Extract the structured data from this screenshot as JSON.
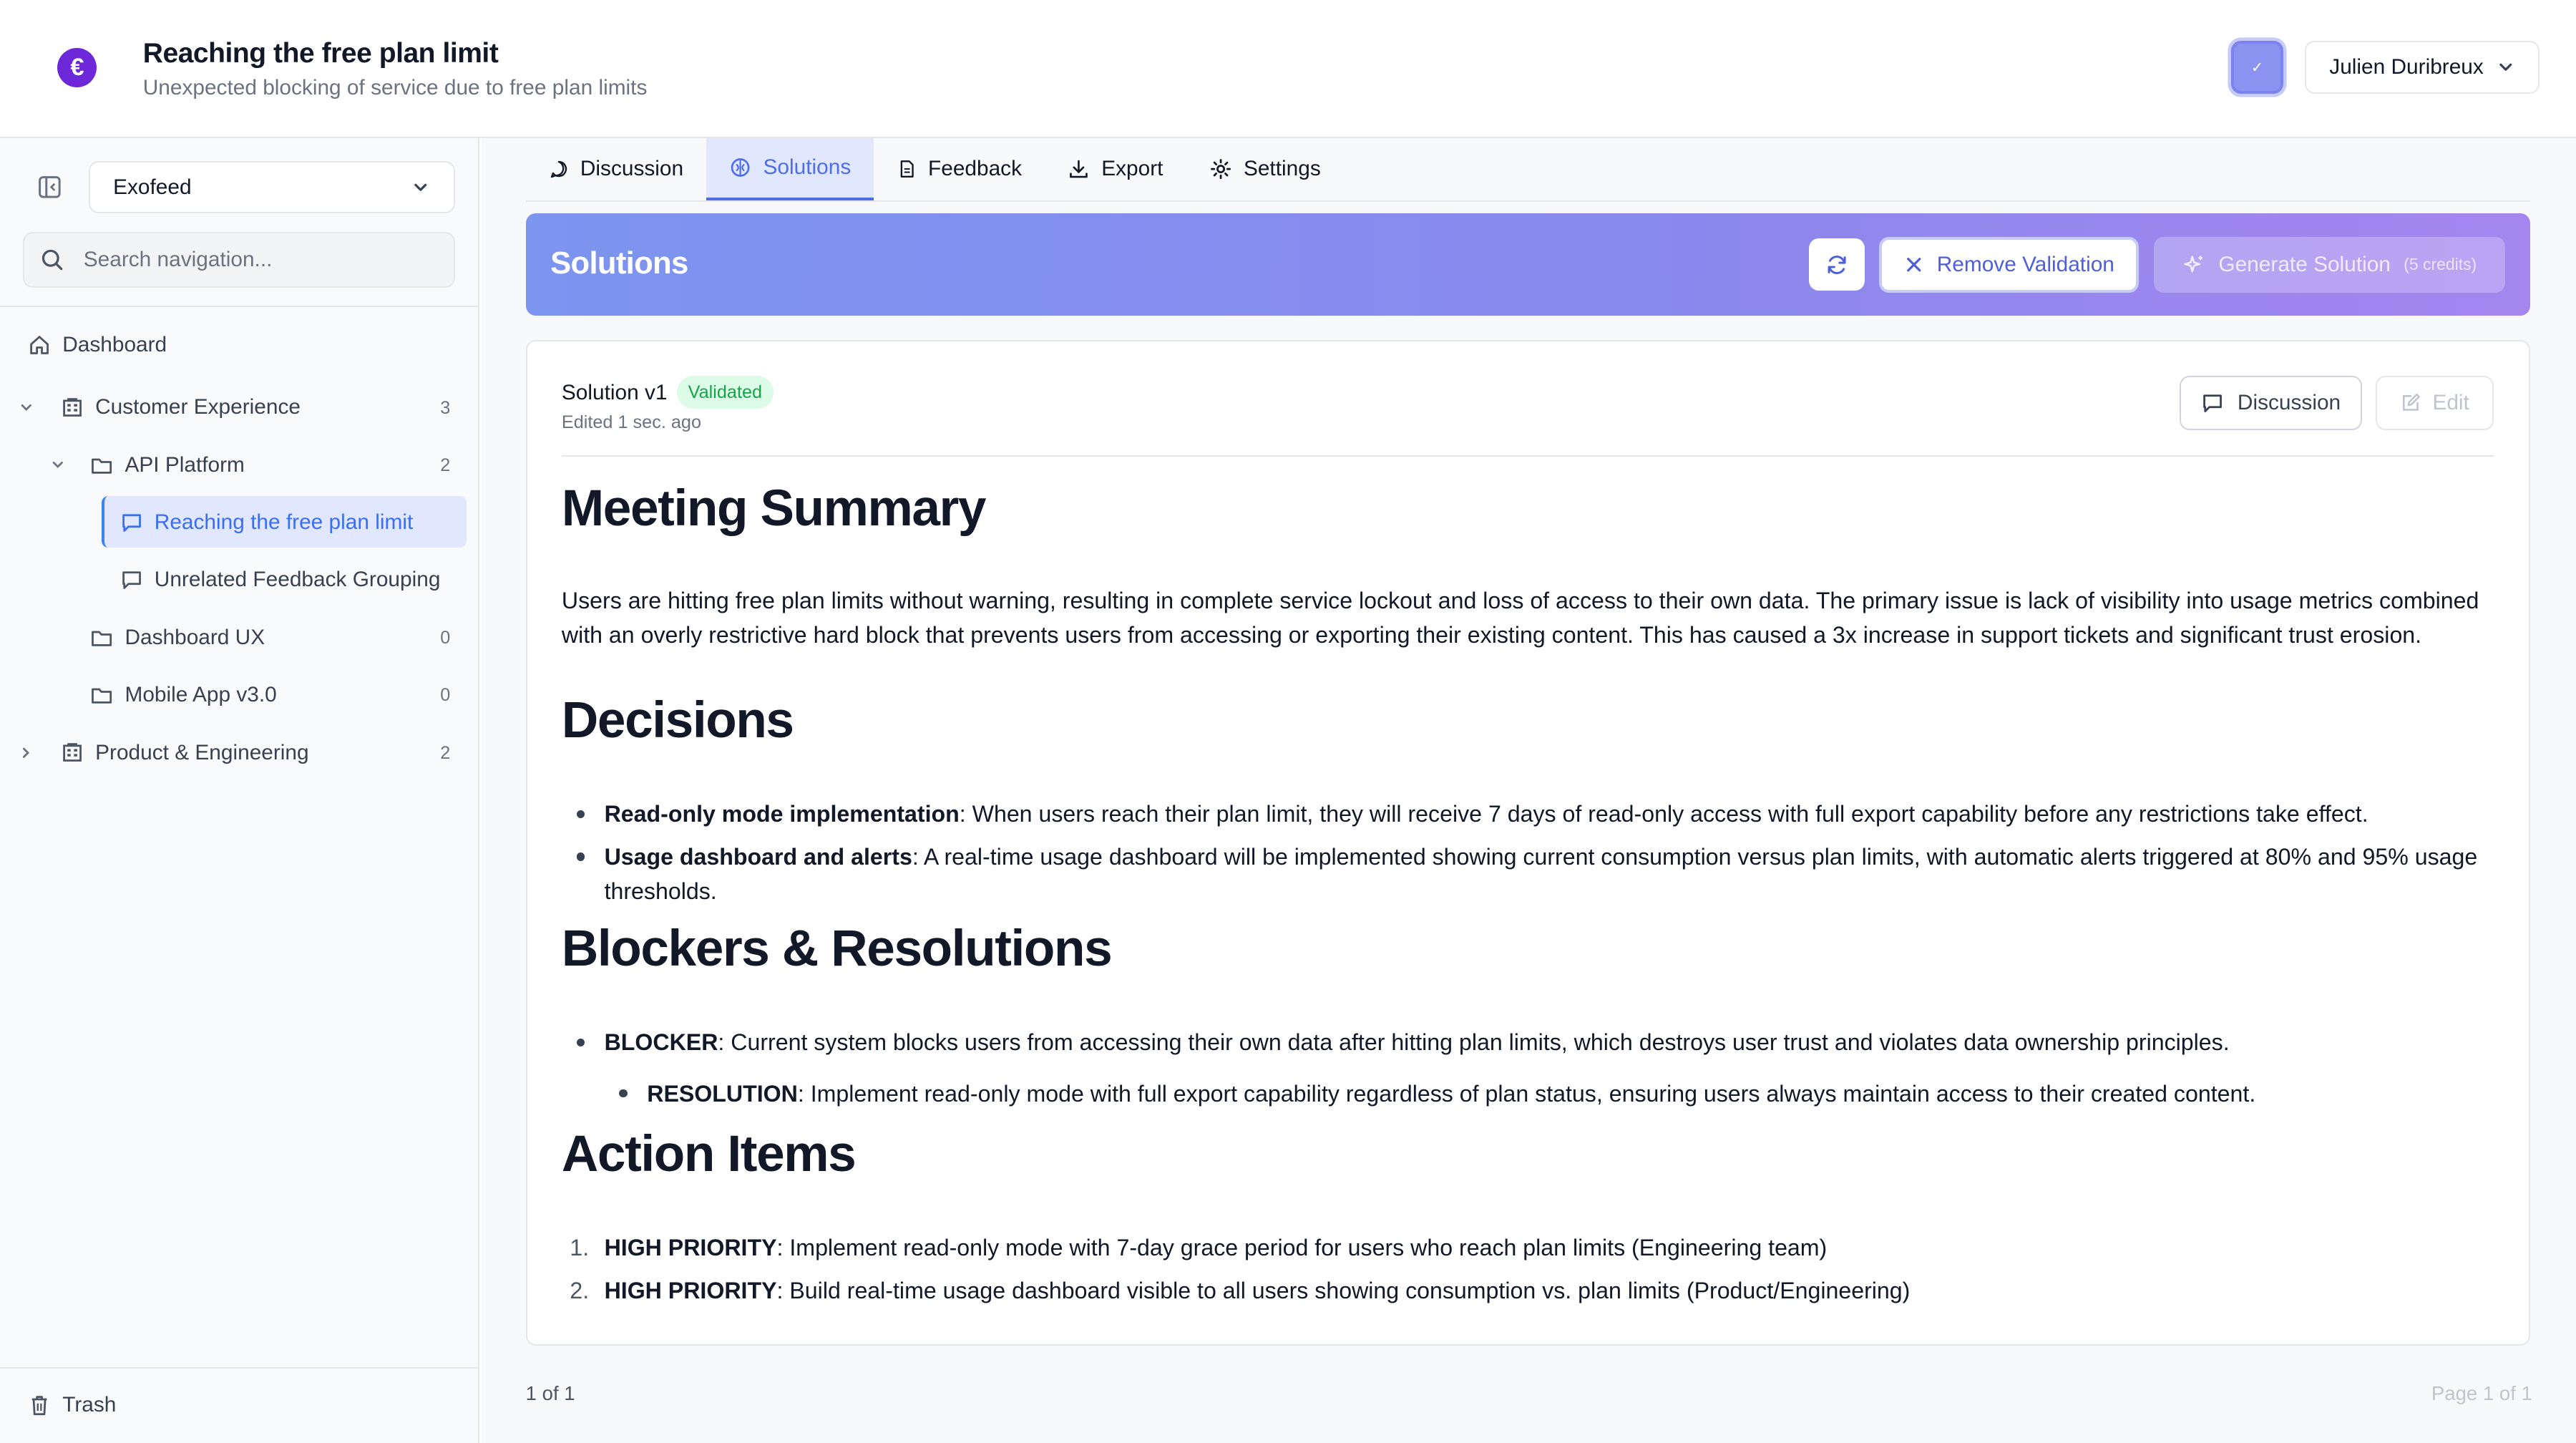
{
  "header": {
    "logo_glyph": "€",
    "title": "Reaching the free plan limit",
    "subtitle": "Unexpected blocking of service due to free plan limits",
    "user_name": "Julien Duribreux",
    "avatar_glyph": "✓"
  },
  "sidebar": {
    "workspace": "Exofeed",
    "search_placeholder": "Search navigation...",
    "dashboard": "Dashboard",
    "tree": [
      {
        "label": "Customer Experience",
        "count": "3"
      },
      {
        "label": "API Platform",
        "count": "2"
      },
      {
        "label": "Reaching the free plan limit"
      },
      {
        "label": "Unrelated Feedback Grouping"
      },
      {
        "label": "Dashboard UX",
        "count": "0"
      },
      {
        "label": "Mobile App v3.0",
        "count": "0"
      },
      {
        "label": "Product & Engineering",
        "count": "2"
      }
    ],
    "trash": "Trash"
  },
  "tabs": [
    "Discussion",
    "Solutions",
    "Feedback",
    "Export",
    "Settings"
  ],
  "banner": {
    "title": "Solutions",
    "remove_label": "Remove Validation",
    "generate_label": "Generate Solution",
    "credits": "(5 credits)"
  },
  "solution": {
    "title": "Solution v1",
    "badge": "Validated",
    "edited": "Edited 1 sec. ago",
    "discussion_label": "Discussion",
    "edit_label": "Edit"
  },
  "document": {
    "h_summary": "Meeting Summary",
    "summary": "Users are hitting free plan limits without warning, resulting in complete service lockout and loss of access to their own data. The primary issue is lack of visibility into usage metrics combined with an overly restrictive hard block that prevents users from accessing or exporting their existing content. This has caused a 3x increase in support tickets and significant trust erosion.",
    "h_decisions": "Decisions",
    "decisions": [
      {
        "bold": "Read-only mode implementation",
        "text": ": When users reach their plan limit, they will receive 7 days of read-only access with full export capability before any restrictions take effect."
      },
      {
        "bold": "Usage dashboard and alerts",
        "text": ": A real-time usage dashboard will be implemented showing current consumption versus plan limits, with automatic alerts triggered at 80% and 95% usage thresholds."
      }
    ],
    "h_blockers": "Blockers & Resolutions",
    "blocker": {
      "bold": "BLOCKER",
      "text": ": Current system blocks users from accessing their own data after hitting plan limits, which destroys user trust and violates data ownership principles."
    },
    "resolution": {
      "bold": "RESOLUTION",
      "text": ": Implement read-only mode with full export capability regardless of plan status, ensuring users always maintain access to their created content."
    },
    "h_actions": "Action Items",
    "actions": [
      {
        "n": "1.",
        "bold": "HIGH PRIORITY",
        "text": ": Implement read-only mode with 7-day grace period for users who reach plan limits (Engineering team)"
      },
      {
        "n": "2.",
        "bold": "HIGH PRIORITY",
        "text": ": Build real-time usage dashboard visible to all users showing consumption vs. plan limits (Product/Engineering)"
      }
    ]
  },
  "footer": {
    "left": "1 of 1",
    "right": "Page 1 of 1"
  },
  "colors": {
    "accent": "#4f6ee6",
    "banner_start": "#7c95ef",
    "banner_end": "#a586ef",
    "validated": "#16a34a",
    "logo": "#6d28d9"
  }
}
